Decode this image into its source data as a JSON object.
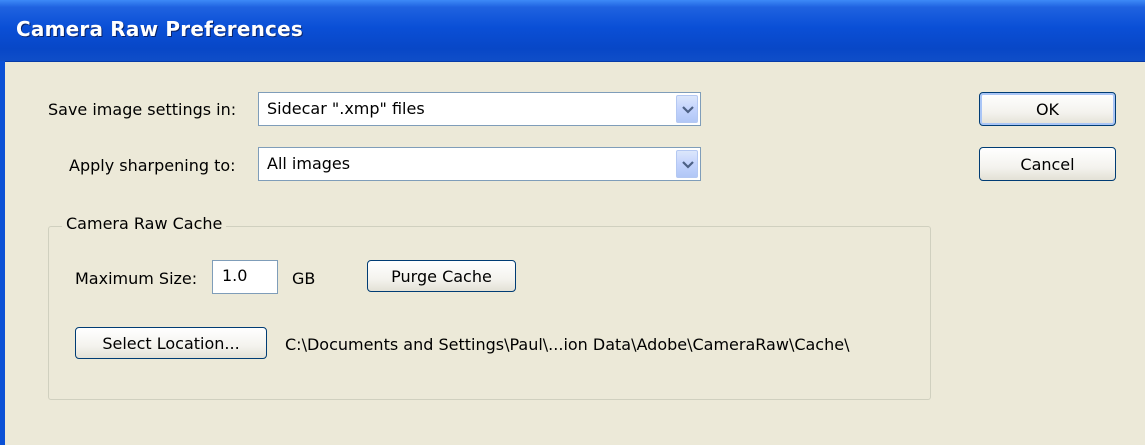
{
  "window": {
    "title": "Camera Raw Preferences"
  },
  "save_settings": {
    "label": "Save image settings in:",
    "value": "Sidecar \".xmp\" files"
  },
  "sharpening": {
    "label": "Apply sharpening to:",
    "value": "All images"
  },
  "buttons": {
    "ok": "OK",
    "cancel": "Cancel"
  },
  "cache": {
    "group_title": "Camera Raw Cache",
    "max_size_label": "Maximum Size:",
    "max_size_value": "1.0",
    "unit": "GB",
    "purge_label": "Purge Cache",
    "select_location_label": "Select Location...",
    "path": "C:\\Documents and Settings\\Paul\\...ion Data\\Adobe\\CameraRaw\\Cache\\"
  },
  "colors": {
    "title_bar": "#0a4fd6",
    "dialog_bg": "#ece9d8",
    "button_border": "#003c74"
  }
}
